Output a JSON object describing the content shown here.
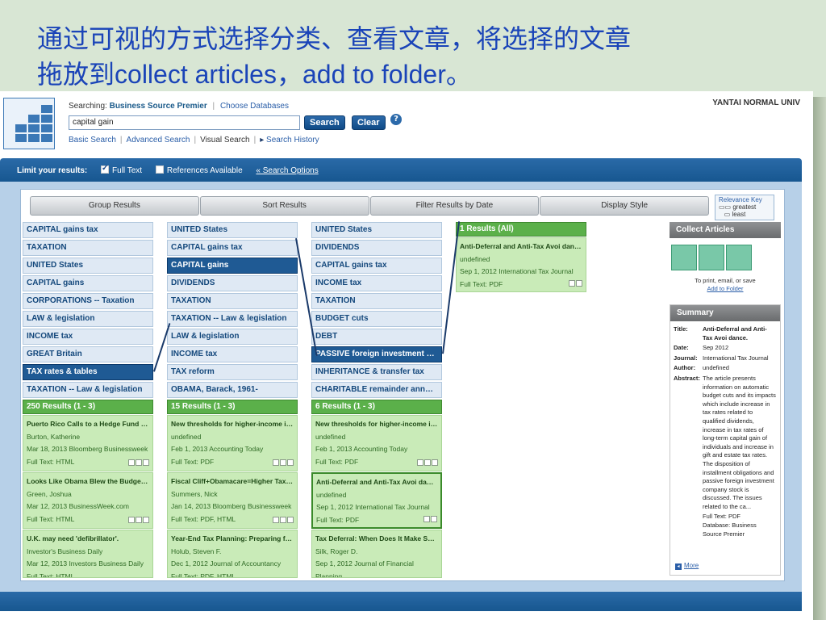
{
  "slide": {
    "title_line1": "通过可视的方式选择分类、查看文章，将选择的文章",
    "title_line2_cn": "拖放到",
    "title_line2_en": "collect articles，add to folder",
    "title_line2_end": "。"
  },
  "header": {
    "searching_label": "Searching:",
    "database": "Business Source Premier",
    "choose_db": "Choose Databases",
    "query": "capital gain",
    "search_btn": "Search",
    "clear_btn": "Clear",
    "help": "?",
    "institution": "YANTAI NORMAL UNIV",
    "links": {
      "basic": "Basic Search",
      "advanced": "Advanced Search",
      "visual": "Visual Search",
      "history": "Search History"
    }
  },
  "limits": {
    "label": "Limit your results:",
    "full_text": "Full Text",
    "refs": "References Available",
    "options": "« Search Options"
  },
  "toolbar": {
    "group": "Group Results",
    "sort": "Sort Results",
    "filter": "Filter Results by Date",
    "display": "Display Style"
  },
  "relevance": {
    "title": "Relevance Key",
    "greatest": "greatest",
    "least": "least"
  },
  "columns": [
    {
      "cells": [
        "CAPITAL gains tax",
        "TAXATION",
        "UNITED States",
        "CAPITAL gains",
        "CORPORATIONS -- Taxation",
        "LAW & legislation",
        "INCOME tax",
        "GREAT Britain",
        "TAX rates & tables",
        "TAXATION -- Law & legislation"
      ],
      "results_head": "250 Results (1 - 3)",
      "results": [
        {
          "title": "Puerto Rico Calls to a Hedge Fund Billio...",
          "author": "Burton, Katherine",
          "src": "Mar 18, 2013 Bloomberg Businessweek",
          "ft": "Full Text: HTML"
        },
        {
          "title": "Looks Like Obama Blew the Budget Neg...",
          "author": "Green, Joshua",
          "src": "Mar 12, 2013 BusinessWeek.com",
          "ft": "Full Text: HTML"
        },
        {
          "title": "U.K. may need 'defibrillator'.",
          "author": "Investor's Business Daily",
          "src": "Mar 12, 2013 Investors Business Daily",
          "ft": "Full Text: HTML"
        }
      ]
    },
    {
      "cells": [
        "UNITED States",
        "CAPITAL gains tax",
        "CAPITAL gains",
        "DIVIDENDS",
        "TAXATION",
        "TAXATION -- Law & legislation",
        "LAW & legislation",
        "INCOME tax",
        "TAX reform",
        "OBAMA, Barack, 1961-"
      ],
      "results_head": "15 Results (1 - 3)",
      "results": [
        {
          "title": "New thresholds for higher-income indivi...",
          "author": "undefined",
          "src": "Feb 1, 2013 Accounting Today",
          "ft": "Full Text: PDF"
        },
        {
          "title": "Fiscal Cliff+Obamacare=Higher Tax on t...",
          "author": "Summers, Nick",
          "src": "Jan 14, 2013 Bloomberg Businessweek",
          "ft": "Full Text: PDF, HTML"
        },
        {
          "title": "Year-End Tax Planning: Preparing for th...",
          "author": "Holub, Steven F.",
          "src": "Dec 1, 2012 Journal of Accountancy",
          "ft": "Full Text: PDF, HTML"
        }
      ]
    },
    {
      "cells": [
        "UNITED States",
        "DIVIDENDS",
        "CAPITAL gains tax",
        "INCOME tax",
        "TAXATION",
        "BUDGET cuts",
        "DEBT",
        "PASSIVE foreign investment co...",
        "INHERITANCE & transfer tax",
        "CHARITABLE remainder annuity..."
      ],
      "results_head": "6 Results (1 - 3)",
      "results": [
        {
          "title": "New thresholds for higher-income indivi...",
          "author": "undefined",
          "src": "Feb 1, 2013 Accounting Today",
          "ft": "Full Text: PDF"
        },
        {
          "title": "Anti-Deferral and Anti-Tax Avoi dance.",
          "author": "undefined",
          "src": "Sep 1, 2012 International Tax Journal",
          "ft": "Full Text: PDF"
        },
        {
          "title": "Tax Deferral: When Does It Make Sense ...",
          "author": "Silk, Roger D.",
          "src": "Sep 1, 2012 Journal of Financial Planning",
          "ft": ""
        }
      ]
    }
  ],
  "all_results": {
    "head": "1 Results (All)",
    "title": "Anti-Deferral and Anti-Tax Avoi dance.",
    "author": "undefined",
    "src": "Sep 1, 2012 International Tax Journal",
    "ft": "Full Text: PDF"
  },
  "collect": {
    "head": "Collect Articles",
    "note": "To print, email, or save",
    "add_link": "Add to Folder"
  },
  "summary": {
    "head": "Summary",
    "title_k": "Title:",
    "title_v": "Anti-Deferral and Anti-Tax Avoi dance.",
    "date_k": "Date:",
    "date_v": "Sep 2012",
    "journal_k": "Journal:",
    "journal_v": "International Tax Journal",
    "author_k": "Author:",
    "author_v": "undefined",
    "abstract_k": "Abstract:",
    "abstract_v": "The article presents information on automatic budget cuts and its impacts which include increase in tax rates related to qualified dividends, increase in tax rates of long-term capital gain of individuals and increase in gift and estate tax rates. The disposition of installment obligations and passive foreign investment company stock is discussed. The issues related to the ca...",
    "ft": "Full Text: PDF",
    "db": "Database: Business Source Premier",
    "more": "More"
  }
}
